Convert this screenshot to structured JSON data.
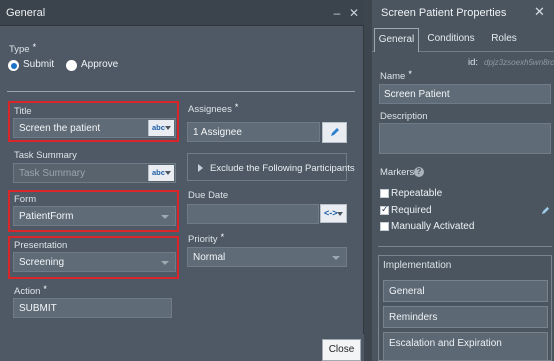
{
  "dialog": {
    "title": "General",
    "type": {
      "label": "Type",
      "required": "*",
      "options": [
        "Submit",
        "Approve"
      ],
      "selected": "Submit"
    },
    "title_field": {
      "label": "Title",
      "value": "Screen the patient",
      "mode": "abc"
    },
    "task_summary": {
      "label": "Task Summary",
      "placeholder": "Task Summary",
      "mode": "abc"
    },
    "form": {
      "label": "Form",
      "value": "PatientForm"
    },
    "presentation": {
      "label": "Presentation",
      "value": "Screening"
    },
    "action": {
      "label": "Action",
      "required": "*",
      "value": "SUBMIT"
    },
    "assignees": {
      "label": "Assignees",
      "required": "*",
      "value": "1 Assignee"
    },
    "exclude_button": "Exclude the Following Participants",
    "due_date": {
      "label": "Due Date",
      "value": "",
      "mode": "<->"
    },
    "priority": {
      "label": "Priority",
      "required": "*",
      "value": "Normal"
    },
    "close_button": "Close"
  },
  "panel": {
    "title": "Screen Patient Properties",
    "tabs": [
      "General",
      "Conditions",
      "Roles"
    ],
    "active_tab": "General",
    "id_label": "id:",
    "id_value": "dpjz3zsoexh5wn8rc",
    "name": {
      "label": "Name",
      "required": "*",
      "value": "Screen Patient"
    },
    "description": {
      "label": "Description",
      "value": ""
    },
    "markers": {
      "label": "Markers",
      "items": [
        {
          "label": "Repeatable",
          "checked": false
        },
        {
          "label": "Required",
          "checked": true
        },
        {
          "label": "Manually Activated",
          "checked": false
        }
      ]
    },
    "implementation": {
      "label": "Implementation",
      "items": [
        "General",
        "Reminders",
        "Escalation and Expiration"
      ]
    }
  },
  "colors": {
    "highlight": "#d9262b",
    "radio_selected": "#1a73c7"
  }
}
